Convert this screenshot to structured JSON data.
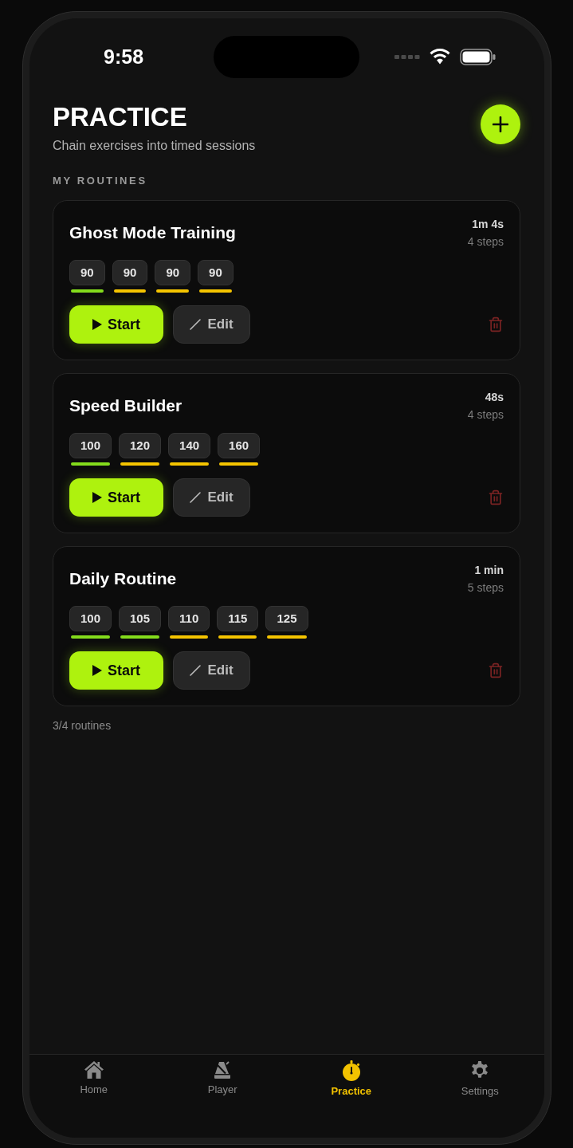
{
  "status_bar": {
    "time": "9:58"
  },
  "header": {
    "title": "PRACTICE",
    "subtitle": "Chain exercises into timed sessions"
  },
  "section_label": "MY ROUTINES",
  "routines": [
    {
      "name": "Ghost Mode Training",
      "duration": "1m 4s",
      "step_count": "4 steps",
      "steps": [
        {
          "tempo": "90",
          "color": "#84dc1c"
        },
        {
          "tempo": "90",
          "color": "#f5c400"
        },
        {
          "tempo": "90",
          "color": "#f5c400"
        },
        {
          "tempo": "90",
          "color": "#f5c400"
        }
      ],
      "start_label": "Start",
      "edit_label": "Edit"
    },
    {
      "name": "Speed Builder",
      "duration": "48s",
      "step_count": "4 steps",
      "steps": [
        {
          "tempo": "100",
          "color": "#84dc1c"
        },
        {
          "tempo": "120",
          "color": "#f5c400"
        },
        {
          "tempo": "140",
          "color": "#f5c400"
        },
        {
          "tempo": "160",
          "color": "#f5c400"
        }
      ],
      "start_label": "Start",
      "edit_label": "Edit"
    },
    {
      "name": "Daily Routine",
      "duration": "1 min",
      "step_count": "5 steps",
      "steps": [
        {
          "tempo": "100",
          "color": "#84dc1c"
        },
        {
          "tempo": "105",
          "color": "#84dc1c"
        },
        {
          "tempo": "110",
          "color": "#f5c400"
        },
        {
          "tempo": "115",
          "color": "#f5c400"
        },
        {
          "tempo": "125",
          "color": "#f5c400"
        }
      ],
      "start_label": "Start",
      "edit_label": "Edit"
    }
  ],
  "footer": "3/4 routines",
  "tab_bar": [
    {
      "kind": "home",
      "label": "Home",
      "selected": false
    },
    {
      "kind": "player",
      "label": "Player",
      "selected": false
    },
    {
      "kind": "practice",
      "label": "Practice",
      "selected": true
    },
    {
      "kind": "settings",
      "label": "Settings",
      "selected": false
    }
  ]
}
